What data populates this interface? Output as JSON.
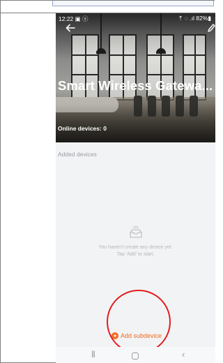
{
  "status_bar": {
    "time": "12:22",
    "status_icons": "▣ ⓢ",
    "right": "⇡ ◌ .ıl 82%▮"
  },
  "header": {
    "title": "Smart Wireless Gatewa...",
    "online_devices": "Online devices: 0",
    "back_icon": "arrow-left",
    "edit_icon": "pencil"
  },
  "content": {
    "section_label": "Added devices",
    "empty_line1": "You haven't create any device yet.",
    "empty_line2": "Tap 'Add' to start.",
    "empty_icon": "empty-box"
  },
  "actions": {
    "add_subdevice_label": "Add subdevice",
    "plus_glyph": "+"
  },
  "nav_bar": {
    "recents": "|||",
    "back": "‹"
  },
  "colors": {
    "accent": "#ee6b1f",
    "highlight": "#e41b1b",
    "muted_text": "#9a9da3",
    "background": "#f2f3f5"
  }
}
